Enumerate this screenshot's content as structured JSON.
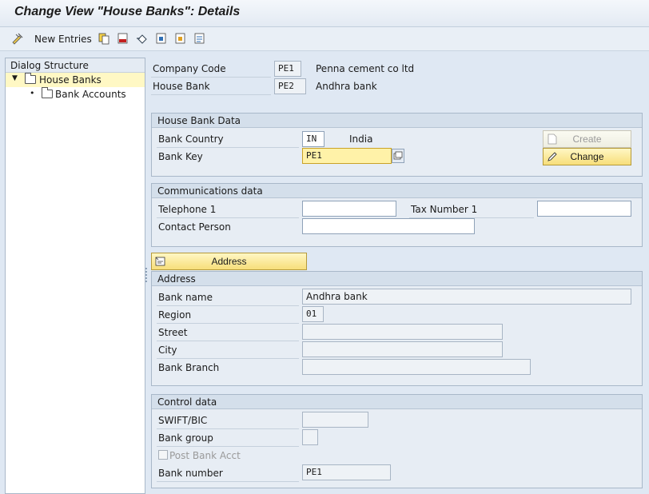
{
  "window": {
    "title": "Change View \"House Banks\": Details"
  },
  "toolbar": {
    "new_entries_label": "New Entries",
    "icons": [
      "edit-icon",
      "copy-icon",
      "delete-icon",
      "undo-icon",
      "select-all-icon",
      "deselect-icon",
      "details-icon"
    ]
  },
  "dialog_structure": {
    "title": "Dialog Structure",
    "items": [
      {
        "label": "House Banks",
        "selected": true,
        "icon": "folder-open-icon"
      },
      {
        "label": "Bank Accounts",
        "selected": false,
        "icon": "folder-icon"
      }
    ]
  },
  "header": {
    "company_code": {
      "label": "Company Code",
      "value": "PE1",
      "text": "Penna cement co ltd"
    },
    "house_bank": {
      "label": "House Bank",
      "value": "PE2",
      "text": "Andhra bank"
    }
  },
  "house_bank_data": {
    "title": "House Bank Data",
    "bank_country": {
      "label": "Bank Country",
      "value": "IN",
      "text": "India"
    },
    "bank_key": {
      "label": "Bank Key",
      "value": "PE1"
    },
    "create_label": "Create",
    "change_label": "Change"
  },
  "communications": {
    "title": "Communications data",
    "telephone": {
      "label": "Telephone 1",
      "value": ""
    },
    "tax_number": {
      "label": "Tax Number 1",
      "value": ""
    },
    "contact_person": {
      "label": "Contact Person",
      "value": ""
    }
  },
  "address_button": {
    "label": "Address"
  },
  "address": {
    "title": "Address",
    "bank_name": {
      "label": "Bank name",
      "value": "Andhra bank"
    },
    "region": {
      "label": "Region",
      "value": "01"
    },
    "street": {
      "label": "Street",
      "value": ""
    },
    "city": {
      "label": "City",
      "value": ""
    },
    "bank_branch": {
      "label": "Bank Branch",
      "value": ""
    }
  },
  "control": {
    "title": "Control data",
    "swift": {
      "label": "SWIFT/BIC",
      "value": ""
    },
    "bank_group": {
      "label": "Bank group",
      "value": ""
    },
    "post_bank_acct": {
      "label": "Post Bank Acct",
      "checked": false
    },
    "bank_number": {
      "label": "Bank number",
      "value": "PE1"
    }
  },
  "colors": {
    "accent": "#f7de7a",
    "panel": "#e7edf4",
    "background": "#dfe8f3"
  }
}
